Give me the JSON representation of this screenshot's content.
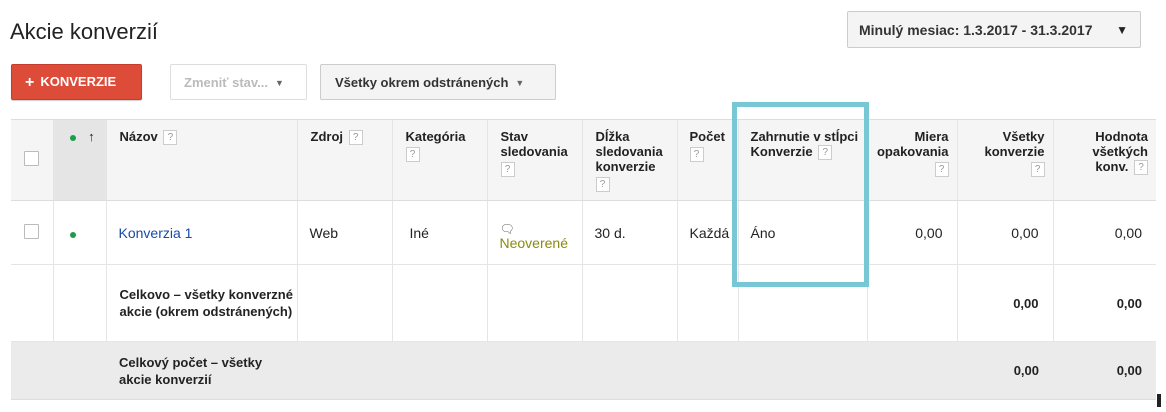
{
  "page": {
    "title": "Akcie konverzií"
  },
  "date_range": {
    "label": "Minulý mesiac: 1.3.2017 - 31.3.2017",
    "caret": "▼"
  },
  "toolbar": {
    "add_label": "KONVERZIE",
    "add_icon": "+",
    "change_state_label": "Zmeniť stav...",
    "filter_label": "Všetky okrem odstránených",
    "dropdown_caret": "▼"
  },
  "table": {
    "headers": {
      "name": "Názov",
      "source": "Zdroj",
      "category": "Kategória",
      "tracking_status": "Stav sledovania",
      "tracking_length": "Dĺžka sledovania konverzie",
      "count": "Počet",
      "include": "Zahrnutie v stĺpci Konverzie",
      "repeat_rate": "Miera opakovania",
      "all_conversions": "Všetky konverzie",
      "all_conv_value": "Hodnota všetkých konv.",
      "help": "?",
      "sort_arrow": "↑"
    },
    "row": {
      "name": "Konverzia 1",
      "source": "Web",
      "category": "Iné",
      "tracking_status": "Neoverené",
      "tracking_length": "30 d.",
      "count": "Každá",
      "include": "Áno",
      "repeat_rate": "0,00",
      "all_conversions": "0,00",
      "all_conv_value": "0,00"
    },
    "total_active": {
      "label": "Celkovo – všetky konverzné akcie (okrem odstránených)",
      "all_conversions": "0,00",
      "all_conv_value": "0,00"
    },
    "total_all": {
      "label": "Celkový počet – všetky akcie konverzií",
      "all_conversions": "0,00",
      "all_conv_value": "0,00"
    }
  },
  "colors": {
    "accent_red": "#dd4b39",
    "highlight": "#78c7d4",
    "status_green": "#1b9e4b",
    "link_blue": "#1a4ba6"
  }
}
